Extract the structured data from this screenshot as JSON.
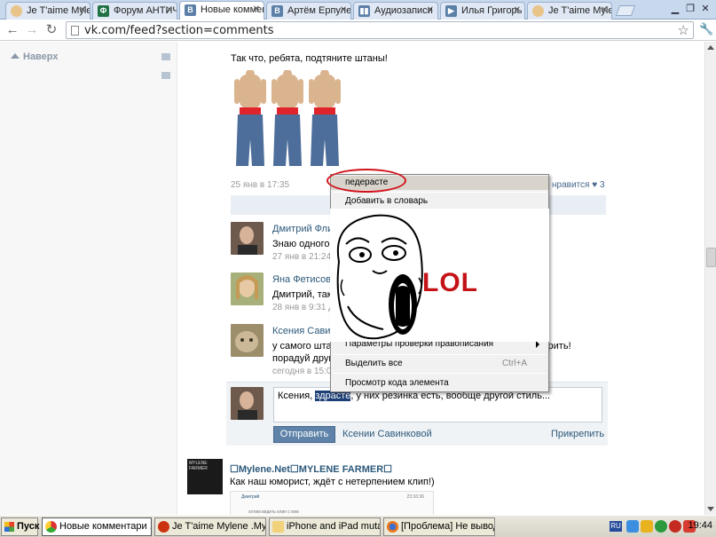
{
  "browser": {
    "tabs": [
      {
        "label": "Je T'aime Myle",
        "icon": "chrome-icon"
      },
      {
        "label": "Форум АНТИЧ",
        "icon": "forum-icon"
      },
      {
        "label": "Новые коммента",
        "icon": "vk-icon",
        "active": true
      },
      {
        "label": "Артём Ерпуле",
        "icon": "vk-icon"
      },
      {
        "label": "Аудиозаписи",
        "icon": "audio-icon"
      },
      {
        "label": "Илья Григорь",
        "icon": "video-icon"
      },
      {
        "label": "Je T'aime Myle",
        "icon": "chrome-icon"
      }
    ],
    "url": "vk.com/feed?section=comments"
  },
  "sidebar": {
    "up_label": "Наверх"
  },
  "post": {
    "text": "Так что, ребята, подтяните штаны!",
    "date": "25 янв в 17:35",
    "likes_label": "нравится",
    "likes_count": "3"
  },
  "comments": [
    {
      "author": "Дмитрий Флинт",
      "text": "Знаю одного так",
      "date": "27 янв в 21:24"
    },
    {
      "author": "Яна Фетисова",
      "text": "Дмитрий, так чт",
      "date": "28 янв в 9:31 Д"
    },
    {
      "author": "Ксения Савинко",
      "text_line1": "у самого штаны",
      "text_end": "дарить!",
      "text_line2": "порадуй друга",
      "date": "сегодня в 15:04"
    }
  ],
  "reply": {
    "prefix": "Ксения, ",
    "selected_word": "здрасте",
    "suffix": ", у них резинка есть, вообще другой стиль...",
    "send_label": "Отправить",
    "reply_to": "Ксении Савинковой",
    "attach_label": "Прикрепить"
  },
  "post2": {
    "avatar_caption": "MYLENE FARMER",
    "title": "☐Mylene.Net☐MYLENE FARMER☐",
    "text": "Как наш юморист, ждёт с нетерпением клип!)",
    "thumb_name": "Дмитрий",
    "thumb_date": "23:16:36",
    "thumb_text": "хотим видеть клип с кем"
  },
  "context_menu": {
    "suggestion": "педерасте",
    "add_to_dictionary": "Добавить в словарь",
    "spellcheck_options": "Параметры проверки правописания",
    "select_all": "Выделить все",
    "select_all_shortcut": "Ctrl+A",
    "inspect": "Просмотр кода элемента"
  },
  "meme": {
    "text": "LOL"
  },
  "taskbar": {
    "start_label": "Пуск",
    "tasks": [
      {
        "label": "Новые комментари ...",
        "active": true
      },
      {
        "label": "Je T'aime Mylene .My Clu..."
      },
      {
        "label": "iPhone and iPad mutant ..."
      },
      {
        "label": "[Проблема] Не выводи..."
      }
    ],
    "lang": "RU",
    "clock": "19:44"
  },
  "colors": {
    "link": "#2b587a",
    "vk_blue": "#5e82a8",
    "annotation_red": "#d0131b"
  }
}
